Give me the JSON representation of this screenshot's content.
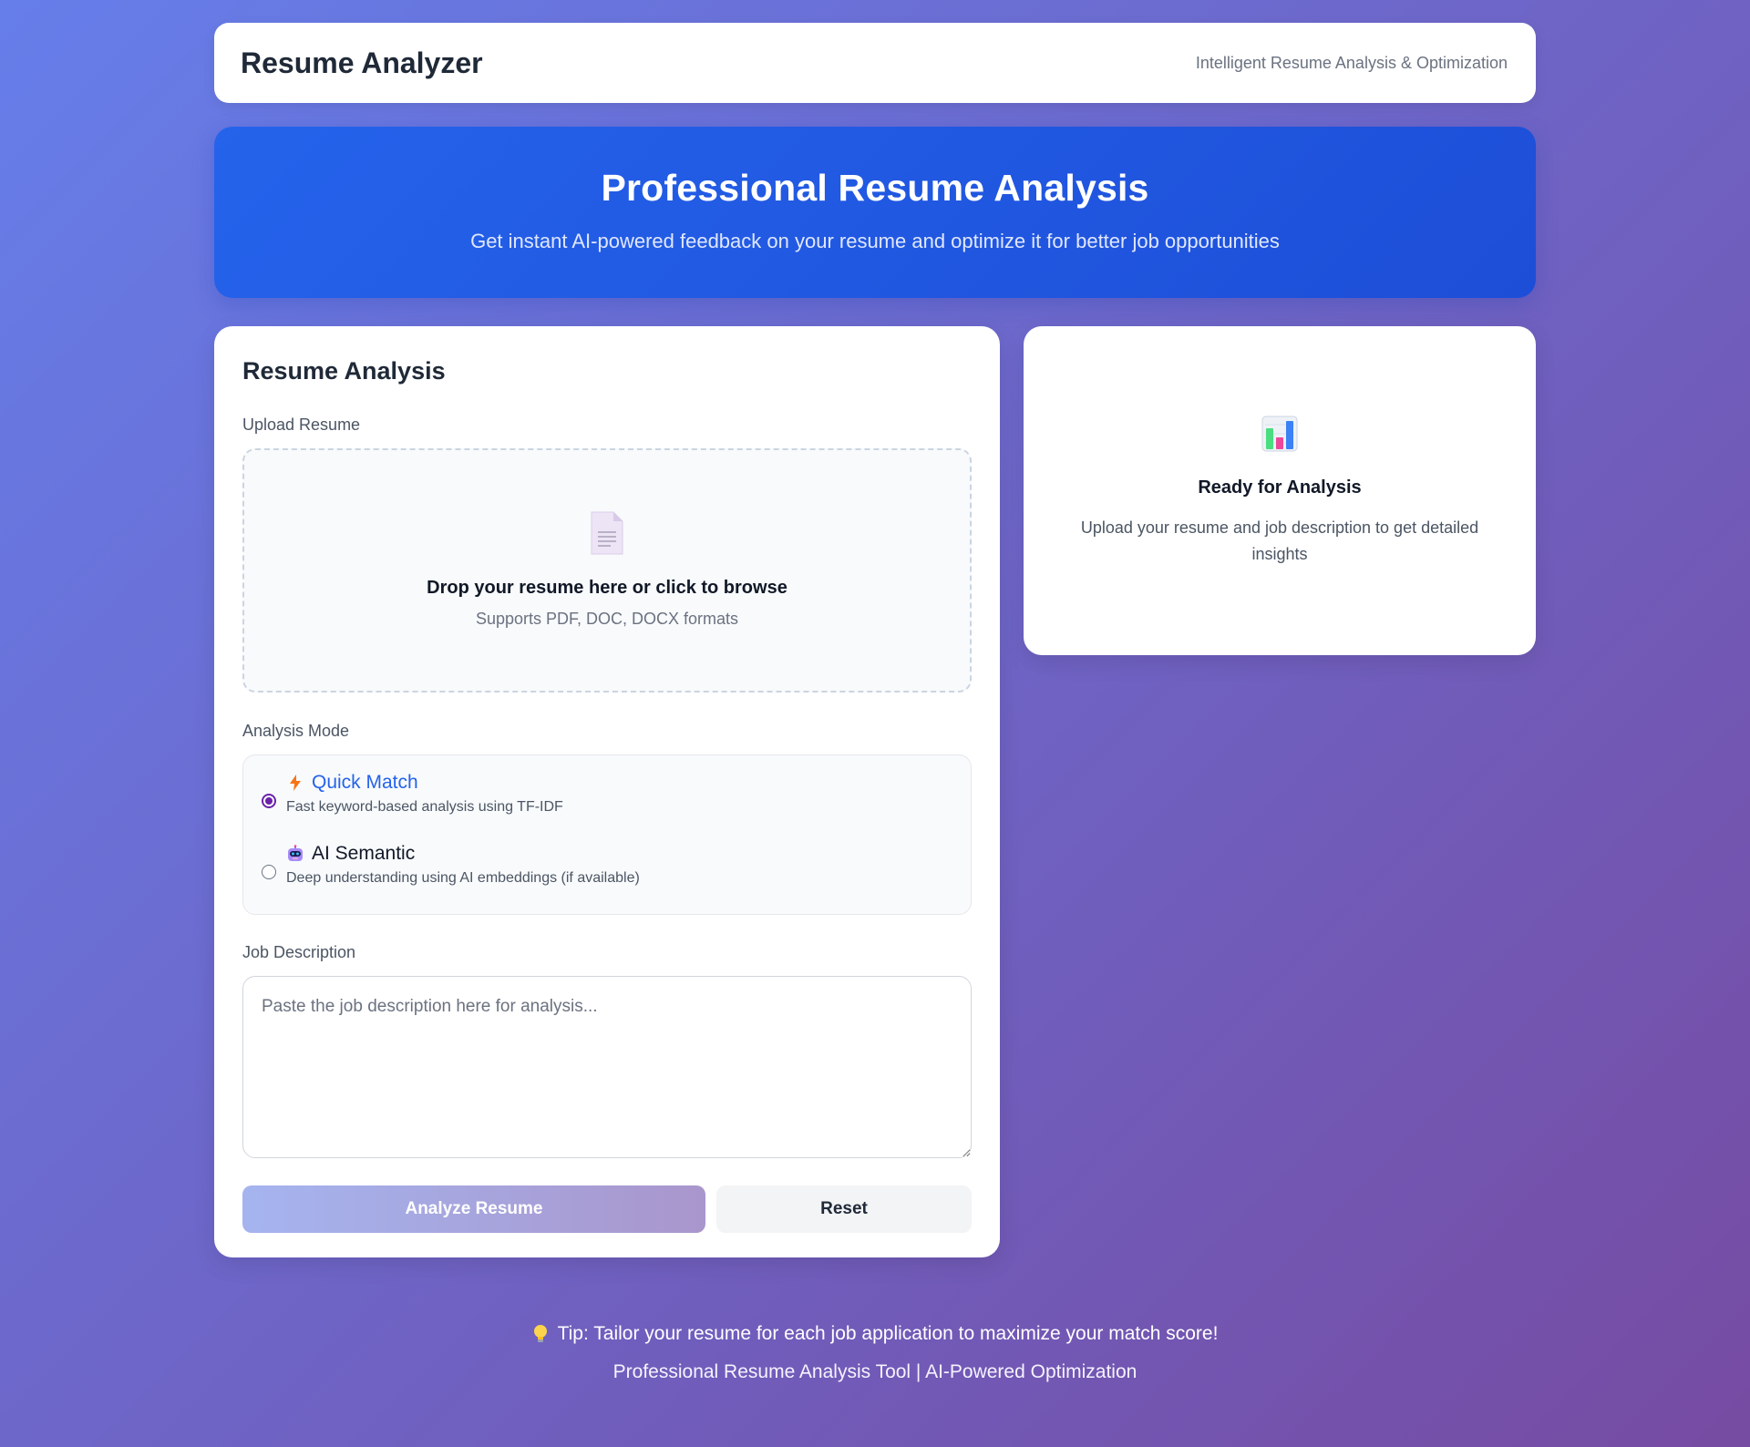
{
  "header": {
    "title": "Resume Analyzer",
    "tagline": "Intelligent Resume Analysis & Optimization"
  },
  "hero": {
    "title": "Professional Resume Analysis",
    "subtitle": "Get instant AI-powered feedback on your resume and optimize it for better job opportunities"
  },
  "analysis": {
    "title": "Resume Analysis",
    "upload_label": "Upload Resume",
    "upload_icon": "document-icon",
    "upload_title": "Drop your resume here or click to browse",
    "upload_sub": "Supports PDF, DOC, DOCX formats",
    "mode_label": "Analysis Mode",
    "modes": [
      {
        "icon": "lightning-icon",
        "title": "Quick Match",
        "desc": "Fast keyword-based analysis using TF-IDF",
        "selected": true
      },
      {
        "icon": "robot-icon",
        "title": "AI Semantic",
        "desc": "Deep understanding using AI embeddings (if available)",
        "selected": false
      }
    ],
    "job_label": "Job Description",
    "job_value": "",
    "job_placeholder": "Paste the job description here for analysis...",
    "analyze_label": "Analyze Resume",
    "reset_label": "Reset"
  },
  "status": {
    "icon": "bar-chart-icon",
    "title": "Ready for Analysis",
    "desc": "Upload your resume and job description to get detailed insights"
  },
  "footer": {
    "tip_icon": "lightbulb-icon",
    "tip": "Tip: Tailor your resume for each job application to maximize your match score!",
    "line": "Professional Resume Analysis Tool | AI-Powered Optimization"
  },
  "colors": {
    "background_start": "#667eea",
    "background_end": "#764ba2",
    "hero": "#2563eb",
    "accent": "#2563eb",
    "radio_selected": "#6b21a8"
  }
}
